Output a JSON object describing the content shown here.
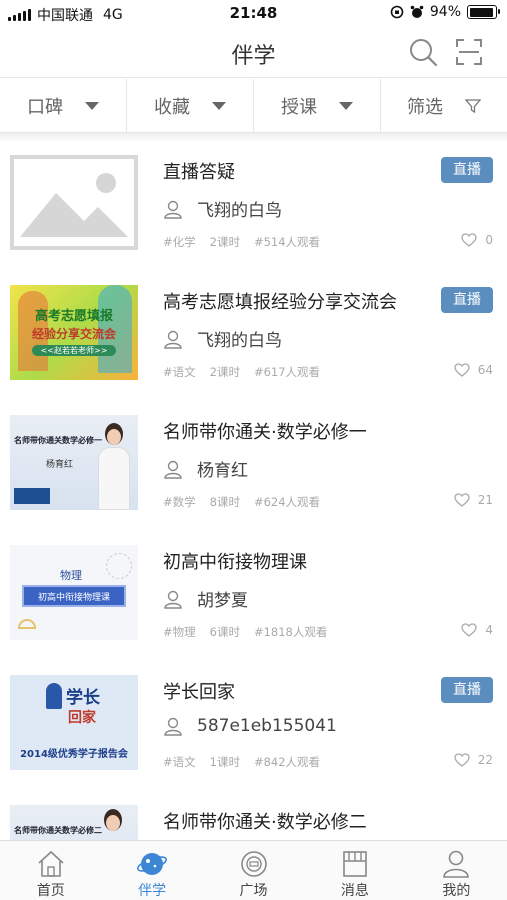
{
  "status": {
    "carrier": "中国联通",
    "network": "4G",
    "time": "21:48",
    "battery": "94%",
    "battery_level": 0.94
  },
  "navbar": {
    "title": "伴学"
  },
  "filters": [
    {
      "label": "口碑",
      "icon": "triangle-down-icon"
    },
    {
      "label": "收藏",
      "icon": "triangle-down-icon"
    },
    {
      "label": "授课",
      "icon": "triangle-down-icon"
    },
    {
      "label": "筛选",
      "icon": "filter-funnel-icon"
    }
  ],
  "courses": [
    {
      "title": "直播答疑",
      "badge": "直播",
      "teacher": "飞翔的白鸟",
      "subject": "#化学",
      "lessons": "2课时",
      "views": "#514人观看",
      "likes": "0",
      "thumb": "placeholder"
    },
    {
      "title": "高考志愿填报经验分享交流会",
      "badge": "直播",
      "teacher": "飞翔的白鸟",
      "subject": "#语文",
      "lessons": "2课时",
      "views": "#617人观看",
      "likes": "64",
      "thumb": "gaokao",
      "thumb_text": {
        "line1": "高考志愿填报",
        "line2": "经验分享交流会",
        "line3": "<<赵若若老师>>"
      }
    },
    {
      "title": "名师带你通关·数学必修一",
      "badge": "",
      "teacher": "杨育红",
      "subject": "#数学",
      "lessons": "8课时",
      "views": "#624人观看",
      "likes": "21",
      "thumb": "teacher",
      "thumb_text": {
        "line1": "名师带你通关数学必修一",
        "line2": "杨育红"
      }
    },
    {
      "title": "初高中衔接物理课",
      "badge": "",
      "teacher": "胡梦夏",
      "subject": "#物理",
      "lessons": "6课时",
      "views": "#1818人观看",
      "likes": "4",
      "thumb": "physics",
      "thumb_text": {
        "line1": "物理",
        "line2": "初高中衔接物理课"
      }
    },
    {
      "title": "学长回家",
      "badge": "直播",
      "teacher": "587e1eb155041",
      "subject": "#语文",
      "lessons": "1课时",
      "views": "#842人观看",
      "likes": "22",
      "thumb": "xuezhang",
      "thumb_text": {
        "line1": "学长",
        "line2": "回家",
        "line3": "2014级优秀学子报告会"
      }
    },
    {
      "title": "名师带你通关·数学必修二",
      "badge": "",
      "teacher": "",
      "subject": "",
      "lessons": "",
      "views": "",
      "likes": "",
      "thumb": "teacher2",
      "thumb_text": {
        "line1": "名师带你通关数学必修二"
      }
    }
  ],
  "tabs": [
    {
      "label": "首页",
      "icon": "home-icon",
      "active": false
    },
    {
      "label": "伴学",
      "icon": "planet-icon",
      "active": true
    },
    {
      "label": "广场",
      "icon": "plaza-icon",
      "active": false
    },
    {
      "label": "消息",
      "icon": "message-icon",
      "active": false
    },
    {
      "label": "我的",
      "icon": "profile-icon",
      "active": false
    }
  ],
  "colors": {
    "accent": "#3d86d6",
    "badge": "#5b8ebf",
    "meta_text": "#aaaaaa"
  }
}
